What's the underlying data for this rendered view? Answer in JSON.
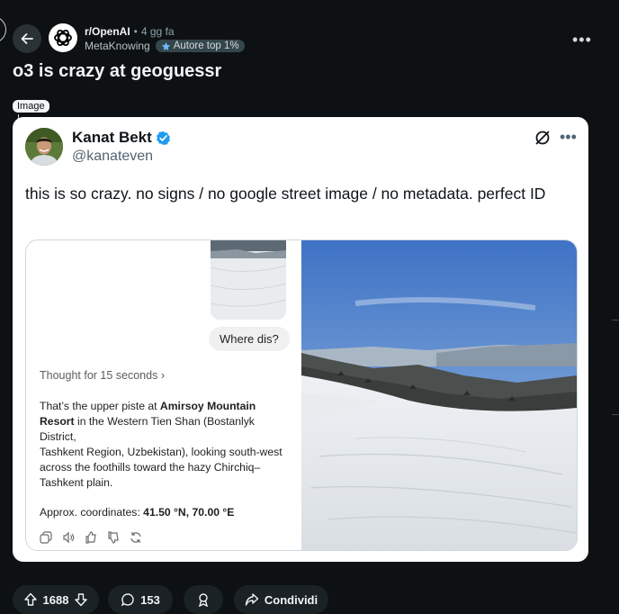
{
  "post": {
    "subreddit": "r/OpenAI",
    "dot": "•",
    "time_ago": "4 gg fa",
    "author": "MetaKnowing",
    "flair": "Autore top 1%",
    "title": "o3 is crazy at geoguessr",
    "media_tag": "Image"
  },
  "tweet": {
    "name": "Kanat Bekt",
    "handle": "@kanateven",
    "text": "this is so crazy. no signs / no google street image / no metadata. perfect ID"
  },
  "chat": {
    "user_message": "Where dis?",
    "thought": "Thought for 15 seconds",
    "answer_intro": "That’s the upper piste at ",
    "answer_bold": "Amirsoy Mountain Resort",
    "answer_rest": " in the Western Tien Shan (Bostanlyk District,",
    "answer_line2": "Tashkent Region, Uzbekistan), looking south-west across the foothills toward the hazy Chirchiq–Tashkent plain.",
    "coords_label": "Approx. coordinates: ",
    "coords_value": "41.50 °N, 70.00 °E"
  },
  "actions": {
    "upvotes": "1688",
    "comments": "153",
    "share": "Condividi"
  },
  "icons": [
    "back-arrow-icon",
    "openai-logo-icon",
    "flair-icon",
    "more-icon",
    "verified-icon",
    "grok-icon",
    "copy-icon",
    "speaker-icon",
    "thumbs-up-icon",
    "thumbs-down-icon",
    "refresh-icon",
    "upvote-icon",
    "downvote-icon",
    "comment-icon",
    "award-icon",
    "share-icon"
  ],
  "colors": {
    "background": "#0e1113",
    "pill": "#1a2226",
    "verified": "#1d9bf0",
    "flair": "#33464c"
  }
}
